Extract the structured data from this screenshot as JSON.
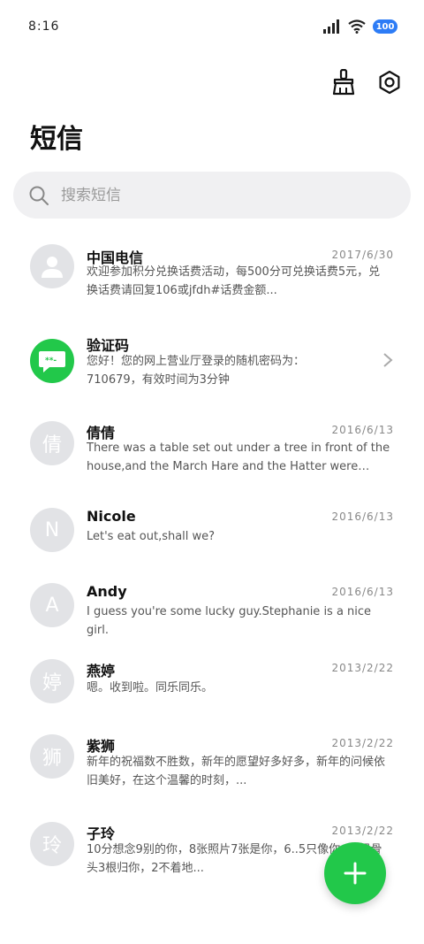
{
  "status_bar": {
    "time": "8:16",
    "battery": "100"
  },
  "header": {
    "title": "短信"
  },
  "search": {
    "placeholder": "搜索短信",
    "value": ""
  },
  "messages": [
    {
      "sender": "中国电信",
      "date": "2017/6/30",
      "avatar_text": "",
      "avatar_icon": "person-icon",
      "snippet": "欢迎参加积分兑换话费活动，每500分可兑换话费5元，兑换话费请回复106或jfdh#话费金额..."
    },
    {
      "sender": "验证码",
      "date": "",
      "avatar_text": "",
      "avatar_icon": "chat-bubble-icon",
      "snippet": "您好！您的网上营业厅登录的随机密码为：710679，有效时间为3分钟"
    },
    {
      "sender": "倩倩",
      "date": "2016/6/13",
      "avatar_text": "倩",
      "snippet": "There was a table set out under a tree in front of the house,and the March Hare and the Hatter were having tea ..."
    },
    {
      "sender": "Nicole",
      "date": "2016/6/13",
      "avatar_text": "N",
      "snippet": "Let's eat out,shall we?"
    },
    {
      "sender": "Andy",
      "date": "2016/6/13",
      "avatar_text": "A",
      "snippet": "I guess you're some lucky guy.Stephanie is a nice girl."
    },
    {
      "sender": "燕婷",
      "date": "2013/2/22",
      "avatar_text": "婷",
      "snippet": "嗯。收到啦。同乐同乐。"
    },
    {
      "sender": "紫狮",
      "date": "2013/2/22",
      "avatar_text": "狮",
      "snippet": "新年的祝福数不胜数，新年的愿望好多好多，新年的问候依旧美好，在这个温馨的时刻，..."
    },
    {
      "sender": "子玲",
      "date": "2013/2/22",
      "avatar_text": "玲",
      "snippet": "10分想念9别的你，8张照片7张是你，6..5只像你，4根骨头3根归你，2不着地..."
    }
  ],
  "colors": {
    "accent": "#22c84a",
    "battery": "#2d7cf6",
    "search_bg": "#f0f0f2",
    "avatar_bg": "#e2e3e6"
  }
}
